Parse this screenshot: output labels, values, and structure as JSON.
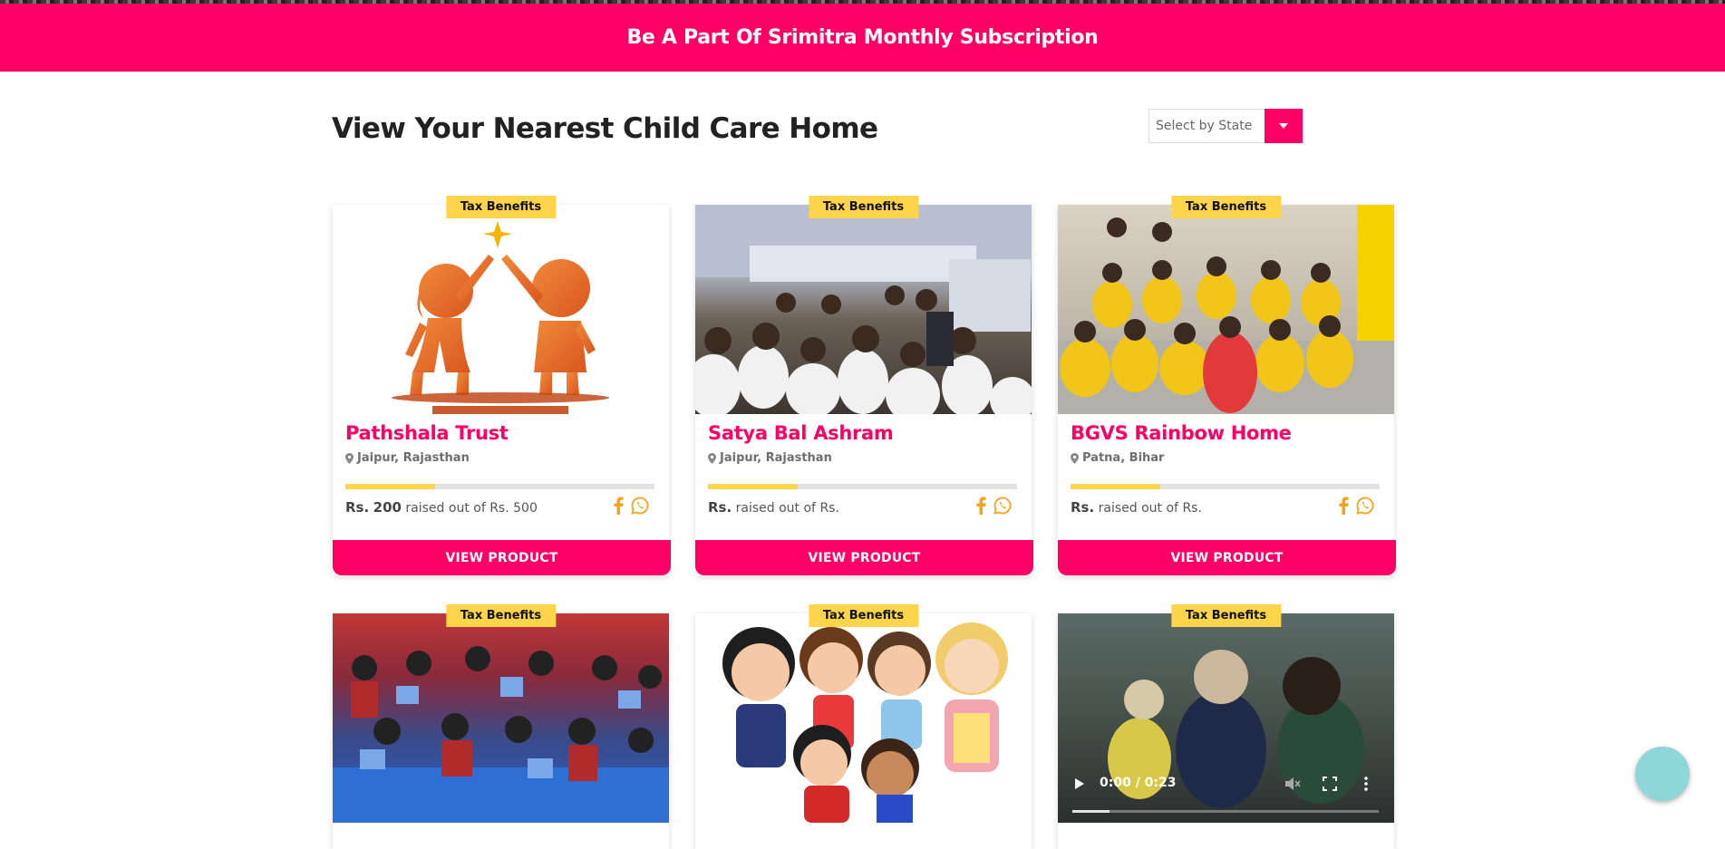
{
  "banner": {
    "text": "Be A Part Of Srimitra Monthly Subscription"
  },
  "page": {
    "heading": "View Your Nearest Child Care Home"
  },
  "filter": {
    "placeholder": "Select by State"
  },
  "cards": [
    {
      "badge": "Tax Benefits",
      "title": "Pathshala Trust",
      "location": "Jaipur, Rajasthan",
      "currency": "Rs.",
      "raised": "200",
      "raised_text": "raised out of",
      "goal_text": "Rs. 500",
      "progress_percent": 29,
      "button": "VIEW PRODUCT"
    },
    {
      "badge": "Tax Benefits",
      "title": "Satya Bal Ashram",
      "location": "Jaipur, Rajasthan",
      "currency": "Rs.",
      "raised": "",
      "raised_text": "raised out of",
      "goal_text": "Rs.",
      "progress_percent": 29,
      "button": "VIEW PRODUCT"
    },
    {
      "badge": "Tax Benefits",
      "title": "BGVS Rainbow Home",
      "location": "Patna, Bihar",
      "currency": "Rs.",
      "raised": "",
      "raised_text": "raised out of",
      "goal_text": "Rs.",
      "progress_percent": 29,
      "button": "VIEW PRODUCT"
    },
    {
      "badge": "Tax Benefits"
    },
    {
      "badge": "Tax Benefits"
    },
    {
      "badge": "Tax Benefits",
      "video_time": "0:00 / 0:23",
      "video_progress_percent": 12
    }
  ],
  "colors": {
    "brand_pink": "#fe0065",
    "badge_yellow": "#fdd54a",
    "icon_orange": "#f7a21b",
    "chat_teal": "#8fd6d8"
  }
}
